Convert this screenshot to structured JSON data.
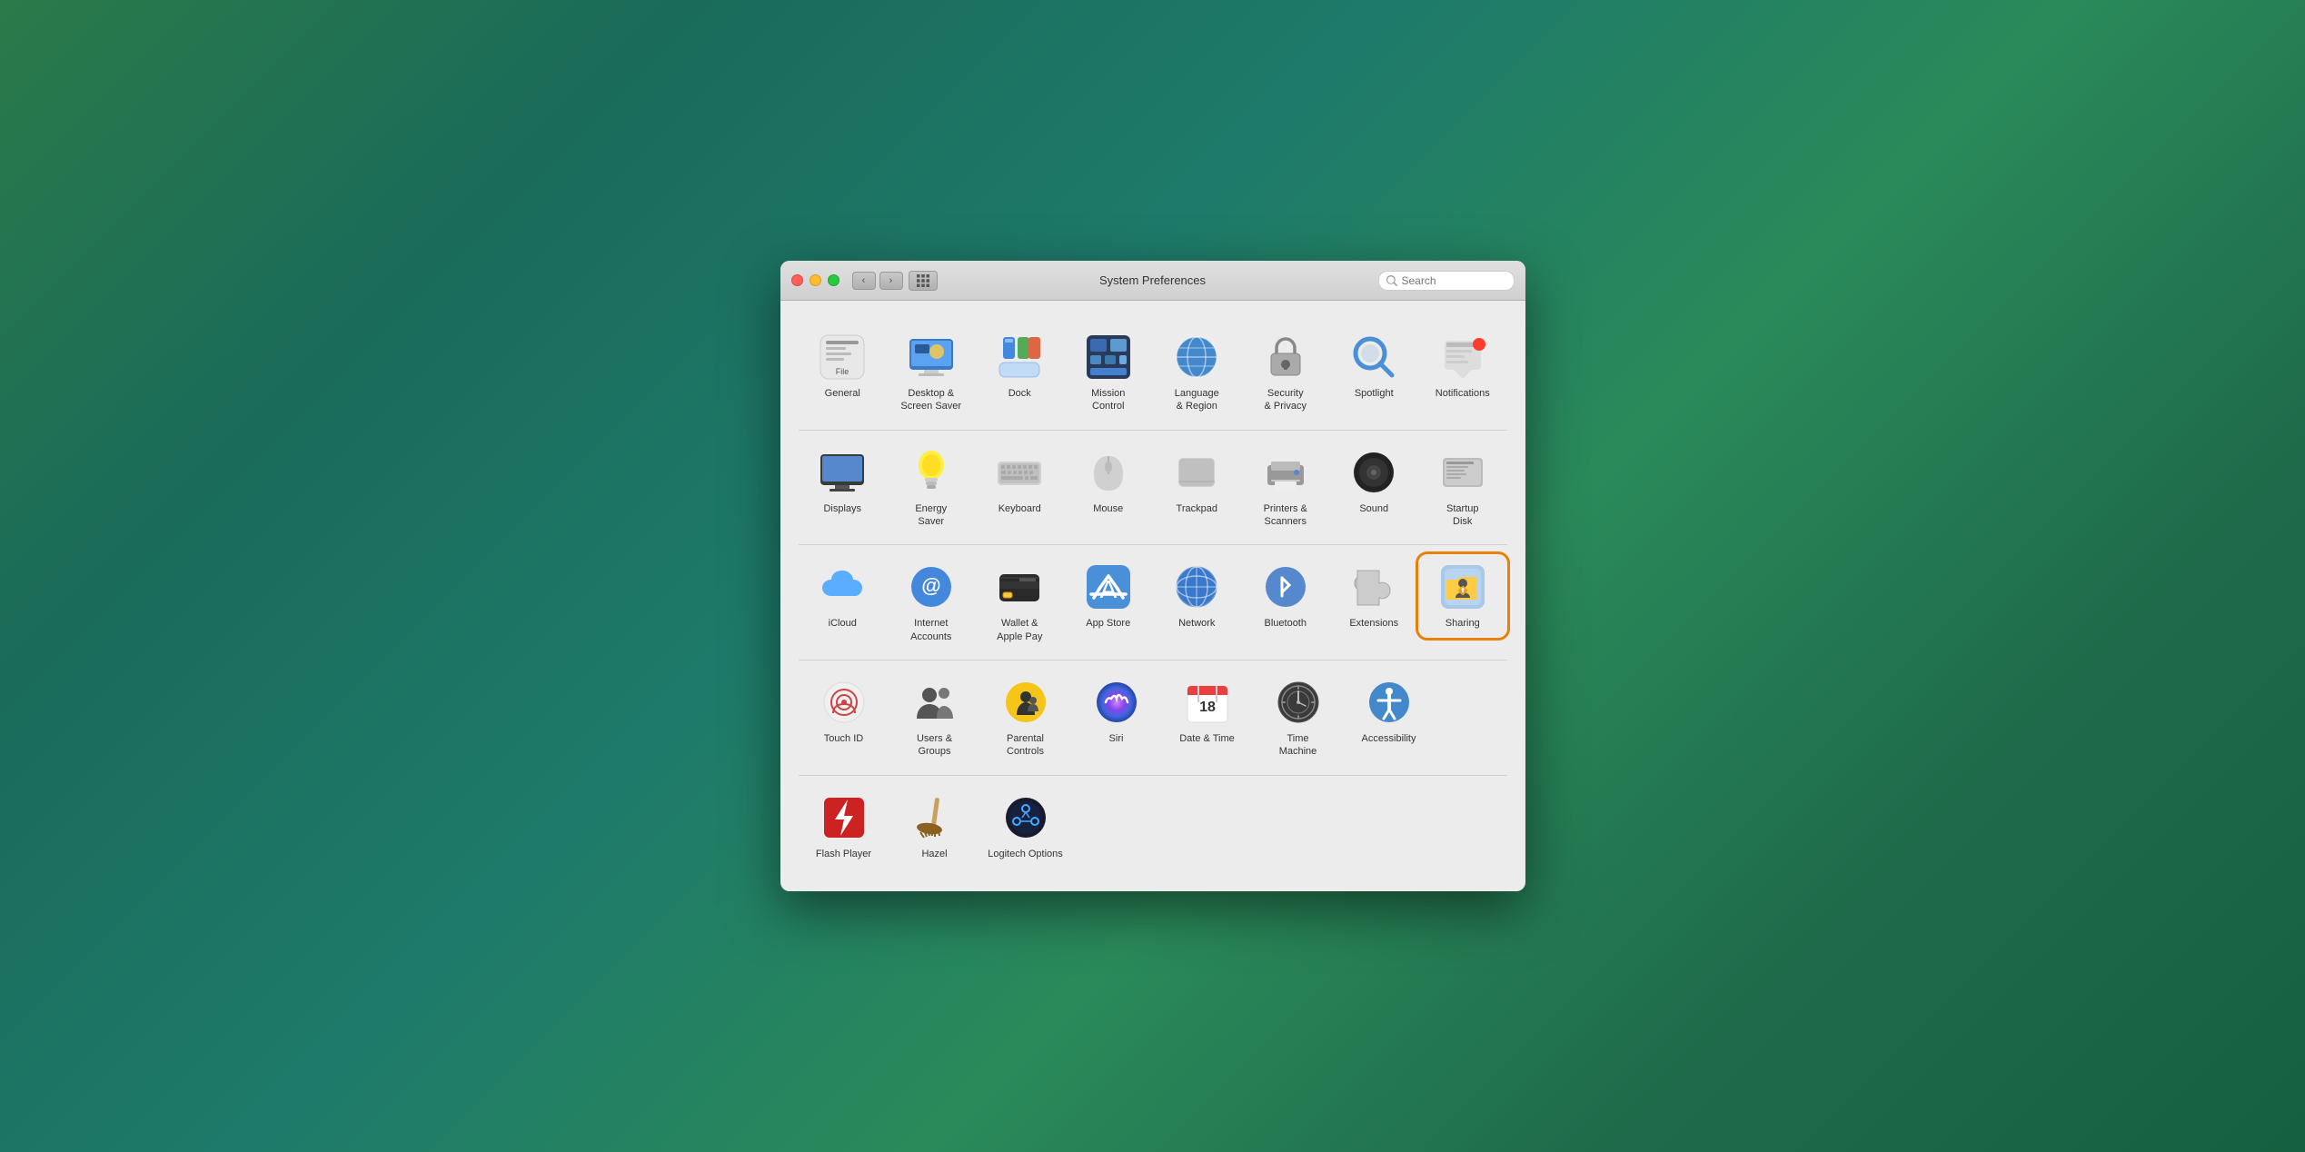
{
  "window": {
    "title": "System Preferences",
    "search_placeholder": "Search"
  },
  "rows": [
    {
      "id": "row1",
      "items": [
        {
          "id": "general",
          "label": "General",
          "icon": "general"
        },
        {
          "id": "desktop-screensaver",
          "label": "Desktop &\nScreen Saver",
          "icon": "desktop"
        },
        {
          "id": "dock",
          "label": "Dock",
          "icon": "dock"
        },
        {
          "id": "mission-control",
          "label": "Mission\nControl",
          "icon": "mission-control"
        },
        {
          "id": "language-region",
          "label": "Language\n& Region",
          "icon": "language-region"
        },
        {
          "id": "security-privacy",
          "label": "Security\n& Privacy",
          "icon": "security-privacy"
        },
        {
          "id": "spotlight",
          "label": "Spotlight",
          "icon": "spotlight"
        },
        {
          "id": "notifications",
          "label": "Notifications",
          "icon": "notifications",
          "badge": true
        }
      ]
    },
    {
      "id": "row2",
      "items": [
        {
          "id": "displays",
          "label": "Displays",
          "icon": "displays"
        },
        {
          "id": "energy-saver",
          "label": "Energy\nSaver",
          "icon": "energy-saver"
        },
        {
          "id": "keyboard",
          "label": "Keyboard",
          "icon": "keyboard"
        },
        {
          "id": "mouse",
          "label": "Mouse",
          "icon": "mouse"
        },
        {
          "id": "trackpad",
          "label": "Trackpad",
          "icon": "trackpad"
        },
        {
          "id": "printers-scanners",
          "label": "Printers &\nScanners",
          "icon": "printers-scanners"
        },
        {
          "id": "sound",
          "label": "Sound",
          "icon": "sound"
        },
        {
          "id": "startup-disk",
          "label": "Startup\nDisk",
          "icon": "startup-disk"
        }
      ]
    },
    {
      "id": "row3",
      "items": [
        {
          "id": "icloud",
          "label": "iCloud",
          "icon": "icloud"
        },
        {
          "id": "internet-accounts",
          "label": "Internet\nAccounts",
          "icon": "internet-accounts"
        },
        {
          "id": "wallet-applepay",
          "label": "Wallet &\nApple Pay",
          "icon": "wallet-applepay"
        },
        {
          "id": "app-store",
          "label": "App Store",
          "icon": "app-store"
        },
        {
          "id": "network",
          "label": "Network",
          "icon": "network"
        },
        {
          "id": "bluetooth",
          "label": "Bluetooth",
          "icon": "bluetooth"
        },
        {
          "id": "extensions",
          "label": "Extensions",
          "icon": "extensions"
        },
        {
          "id": "sharing",
          "label": "Sharing",
          "icon": "sharing",
          "selected": true
        }
      ]
    },
    {
      "id": "row4",
      "items": [
        {
          "id": "touch-id",
          "label": "Touch ID",
          "icon": "touch-id"
        },
        {
          "id": "users-groups",
          "label": "Users &\nGroups",
          "icon": "users-groups"
        },
        {
          "id": "parental-controls",
          "label": "Parental\nControls",
          "icon": "parental-controls"
        },
        {
          "id": "siri",
          "label": "Siri",
          "icon": "siri"
        },
        {
          "id": "date-time",
          "label": "Date & Time",
          "icon": "date-time"
        },
        {
          "id": "time-machine",
          "label": "Time\nMachine",
          "icon": "time-machine"
        },
        {
          "id": "accessibility",
          "label": "Accessibility",
          "icon": "accessibility"
        }
      ]
    },
    {
      "id": "row5",
      "items": [
        {
          "id": "flash-player",
          "label": "Flash Player",
          "icon": "flash-player"
        },
        {
          "id": "hazel",
          "label": "Hazel",
          "icon": "hazel"
        },
        {
          "id": "logitech-options",
          "label": "Logitech Options",
          "icon": "logitech-options"
        }
      ]
    }
  ]
}
